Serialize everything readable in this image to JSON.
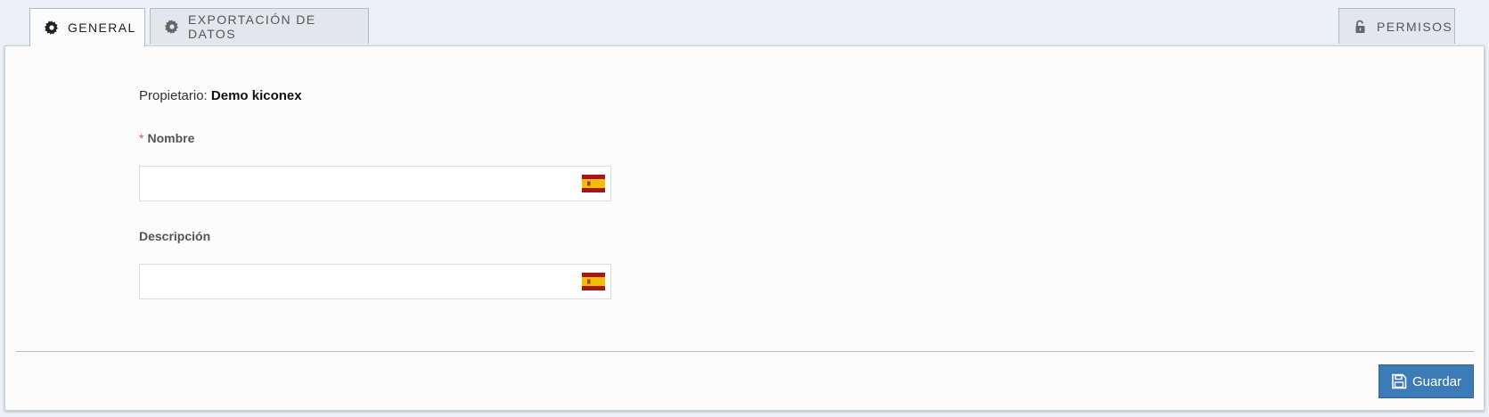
{
  "tabs": {
    "general": {
      "label": "GENERAL",
      "icon": "gear-icon"
    },
    "export": {
      "label": "EXPORTACIÓN DE DATOS",
      "icon": "gear-icon"
    },
    "permissions": {
      "label": "PERMISOS",
      "icon": "unlock-icon"
    }
  },
  "form": {
    "owner_label": "Propietario:",
    "owner_value": "Demo kiconex",
    "required_marker": "*",
    "name_label": "Nombre",
    "name_value": "",
    "description_label": "Descripción",
    "description_value": "",
    "language_flag": "spain-flag-icon"
  },
  "footer": {
    "save_label": "Guardar",
    "save_icon": "floppy-disk-icon"
  },
  "colors": {
    "primary": "#3c7bb6",
    "required": "#d9534f",
    "border": "#a9bdd0"
  }
}
